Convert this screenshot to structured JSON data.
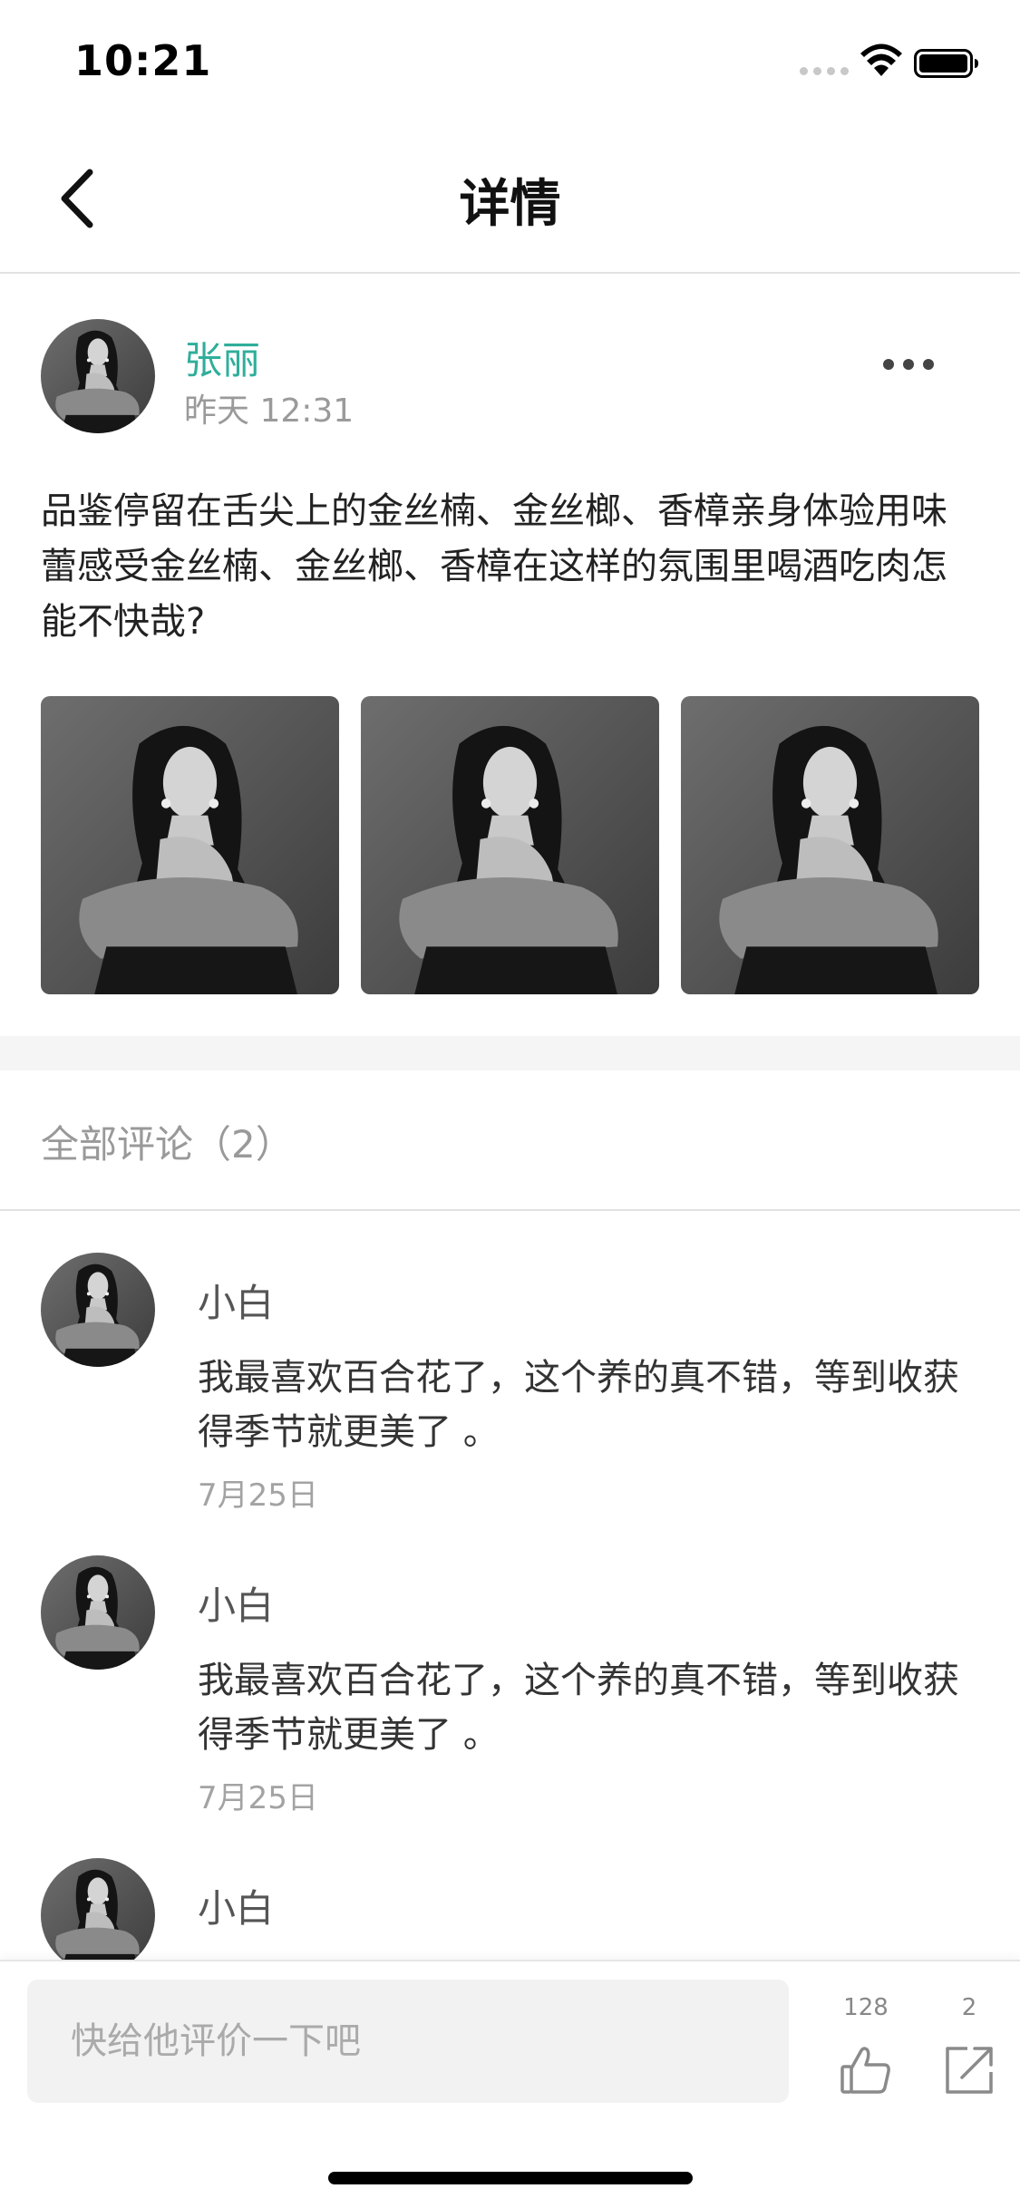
{
  "status_bar": {
    "time": "10:21"
  },
  "nav": {
    "title": "详情"
  },
  "post": {
    "author": "张丽",
    "time": "昨天 12:31",
    "body": "品鉴停留在舌尖上的金丝楠、金丝榔、香樟亲身体验用味蕾感受金丝楠、金丝榔、香樟在这样的氛围里喝酒吃肉怎能不快哉?",
    "photo_count": 3
  },
  "comments": {
    "header": "全部评论（2）",
    "items": [
      {
        "name": "小白",
        "text": "我最喜欢百合花了，这个养的真不错，等到收获得季节就更美了 。",
        "date": "7月25日"
      },
      {
        "name": "小白",
        "text": "我最喜欢百合花了，这个养的真不错，等到收获得季节就更美了 。",
        "date": "7月25日"
      },
      {
        "name": "小白",
        "text": "",
        "date": ""
      }
    ]
  },
  "bottom_bar": {
    "input_placeholder": "快给他评价一下吧",
    "like_count": "128",
    "share_count": "2",
    "like_icon": "thumbs-up-icon",
    "share_icon": "share-icon"
  },
  "colors": {
    "accent": "#2fae9b",
    "divider": "#e2e2e2",
    "muted_text": "#9a9a9a"
  }
}
